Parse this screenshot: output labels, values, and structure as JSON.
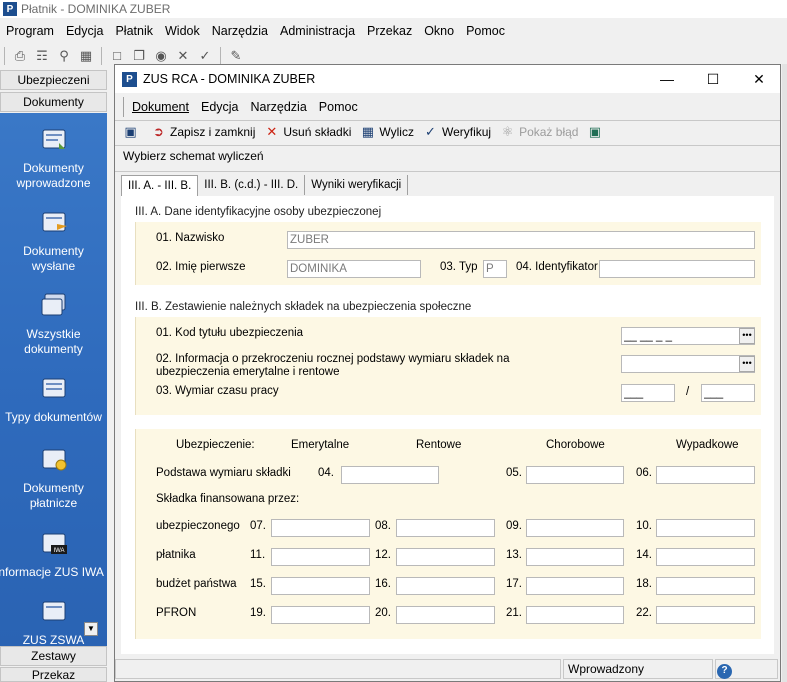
{
  "app": {
    "title": "Płatnik - DOMINIKA ZUBER",
    "logo_letter": "P",
    "menu": [
      "Program",
      "Edycja",
      "Płatnik",
      "Widok",
      "Narzędzia",
      "Administracja",
      "Przekaz",
      "Okno",
      "Pomoc"
    ]
  },
  "sidebar": {
    "headers_top": [
      "Ubezpieczeni",
      "Dokumenty"
    ],
    "items": [
      {
        "label": "Dokumenty wprowadzone",
        "icon": "documents-in-icon"
      },
      {
        "label": "Dokumenty wysłane",
        "icon": "documents-sent-icon"
      },
      {
        "label": "Wszystkie dokumenty",
        "icon": "all-documents-icon"
      },
      {
        "label": "Typy dokumentów",
        "icon": "document-types-icon"
      },
      {
        "label": "Dokumenty płatnicze",
        "icon": "payment-documents-icon"
      },
      {
        "label": "Informacje ZUS IWA",
        "icon": "iwa-icon",
        "badge": "IWA"
      },
      {
        "label": "ZUS ZSWA",
        "icon": "zswa-icon"
      }
    ],
    "headers_bottom": [
      "Zestawy",
      "Przekaz"
    ]
  },
  "dialog": {
    "title": "ZUS RCA - DOMINIKA ZUBER",
    "logo_letter": "P",
    "menu": [
      "Dokument",
      "Edycja",
      "Narzędzia",
      "Pomoc"
    ],
    "toolbar": {
      "save_close": "Zapisz i zamknij",
      "delete_contrib": "Usuń składki",
      "calculate": "Wylicz",
      "verify": "Weryfikuj",
      "show_error": "Pokaż błąd"
    },
    "schema_label": "Wybierz schemat wyliczeń",
    "tabs": [
      "III. A. - III. B.",
      "III. B. (c.d.) - III. D.",
      "Wyniki weryfikacji"
    ],
    "section_a": {
      "title": "III. A. Dane identyfikacyjne osoby ubezpieczonej",
      "surname_label": "01. Nazwisko",
      "surname_value": "ZUBER",
      "firstname_label": "02. Imię pierwsze",
      "firstname_value": "DOMINIKA",
      "type_label": "03. Typ",
      "type_value": "P",
      "id_label": "04. Identyfikator",
      "id_value": ""
    },
    "section_b": {
      "title": "III. B. Zestawienie należnych składek na ubezpieczenia społeczne",
      "code_label": "01. Kod tytułu ubezpieczenia",
      "code_mask": "__ __ _ _",
      "exceed_label_1": "02. Informacja o przekroczeniu rocznej podstawy wymiaru składek na",
      "exceed_label_2": "ubezpieczenia emerytalne i rentowe",
      "worktime_label": "03. Wymiar czasu pracy",
      "worktime_a": "___",
      "worktime_slash": "/",
      "worktime_b": "___"
    },
    "contrib": {
      "col_header": "Ubezpieczenie:",
      "columns": [
        "Emerytalne",
        "Rentowe",
        "Chorobowe",
        "Wypadkowe"
      ],
      "base_label": "Podstawa wymiaru składki",
      "base_fields": [
        "04.",
        "05.",
        "06."
      ],
      "funded_label": "Składka finansowana przez:",
      "rows": [
        {
          "label": "ubezpieczonego",
          "nums": [
            "07.",
            "08.",
            "09.",
            "10."
          ]
        },
        {
          "label": "płatnika",
          "nums": [
            "11.",
            "12.",
            "13.",
            "14."
          ]
        },
        {
          "label": "budżet państwa",
          "nums": [
            "15.",
            "16.",
            "17.",
            "18."
          ]
        },
        {
          "label": "PFRON",
          "nums": [
            "19.",
            "20.",
            "21.",
            "22."
          ]
        }
      ]
    },
    "status": "Wprowadzony",
    "help_glyph": "?"
  },
  "colors": {
    "sidebar_blue": "#2f6bbd",
    "section_bg": "#fdf8e4",
    "logo_blue": "#1d4e8f"
  }
}
